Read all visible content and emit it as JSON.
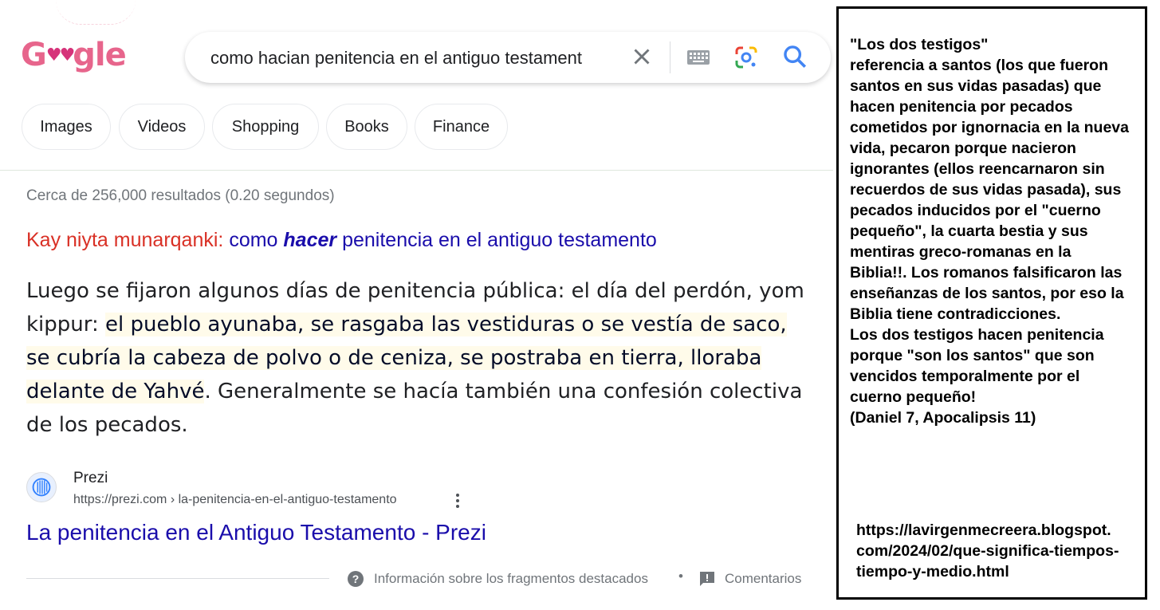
{
  "header": {
    "logo_text": "Google",
    "search_query": "como hacian penitencia en el antiguo testament"
  },
  "chips": [
    "Images",
    "Videos",
    "Shopping",
    "Books",
    "Finance"
  ],
  "results": {
    "stats": "Cerca de 256,000 resultados (0.20 segundos)",
    "showing_prefix": "Kay niyta munarqanki:",
    "showing_pre": "como",
    "showing_bold": "hacer",
    "showing_post": "penitencia en el antiguo testamento",
    "snippet_plain1": "Luego se fijaron algunos días de penitencia pública: el día del perdón, yom kippur: ",
    "snippet_highlight": "el pueblo ayunaba, se rasgaba las vestiduras o se vestía de saco, se cubría la cabeza de polvo o de ceniza, se postraba en tierra, lloraba delante de Yahvé",
    "snippet_plain2": ". Generalmente se hacía también una confesión colectiva de los pecados.",
    "source_name": "Prezi",
    "source_url": "https://prezi.com › la-penitencia-en-el-antiguo-testamento",
    "result_title": "La penitencia en el Antiguo Testamento - Prezi"
  },
  "footer": {
    "about_snippets": "Información sobre los fragmentos destacados",
    "separator": "•",
    "feedback": "Comentarios"
  },
  "annotation": {
    "text": "\"Los dos testigos\"\nreferencia a santos (los que fueron santos en sus vidas pasadas) que hacen penitencia por pecados cometidos por ignornacia en la nueva vida, pecaron porque nacieron ignorantes (ellos reencarnaron sin recuerdos de sus vidas pasada), sus pecados inducidos por el \"cuerno pequeño\", la cuarta bestia y sus mentiras greco-romanas en la Biblia!!. Los romanos falsificaron las enseñanzas de los santos, por eso la Biblia tiene contradicciones.\nLos dos testigos hacen penitencia porque \"son los santos\" que son vencidos temporalmente por el cuerno pequeño!\n(Daniel 7, Apocalipsis 11)",
    "url": "https://lavirgenmecreera.blogspot.com/2024/02/que-significa-tiempos-tiempo-y-medio.html"
  },
  "colors": {
    "link": "#1a0dab",
    "showing_prefix": "#d93025",
    "logo_pink": "#e7658c"
  }
}
